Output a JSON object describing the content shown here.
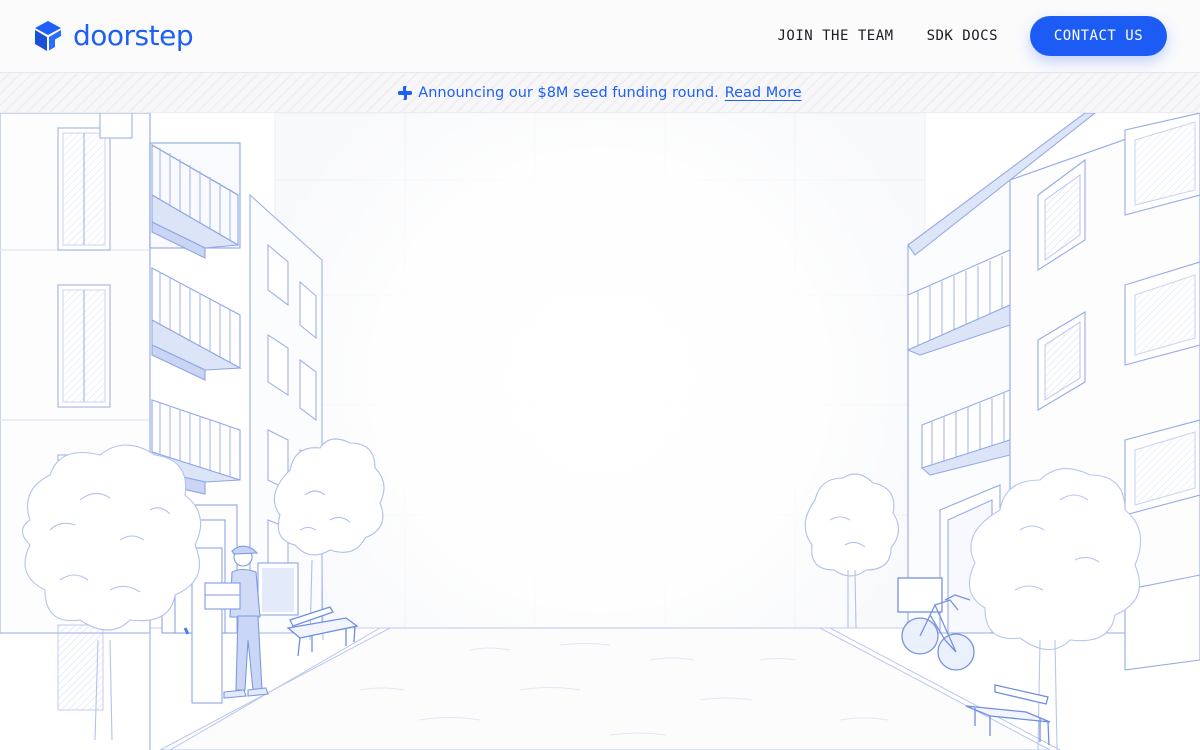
{
  "brand": {
    "name": "doorstep",
    "color": "#1e5ff5",
    "logo_icon": "cube-icon"
  },
  "nav": {
    "items": [
      {
        "label": "JOIN THE TEAM"
      },
      {
        "label": "SDK DOCS"
      }
    ],
    "cta_label": "CONTACT US"
  },
  "announcement": {
    "icon": "sparkle-icon",
    "text": "Announcing our $8M seed funding round.",
    "link_label": "Read More"
  },
  "hero": {
    "illustration": "street-scene",
    "accent": "#9fb4ea"
  }
}
